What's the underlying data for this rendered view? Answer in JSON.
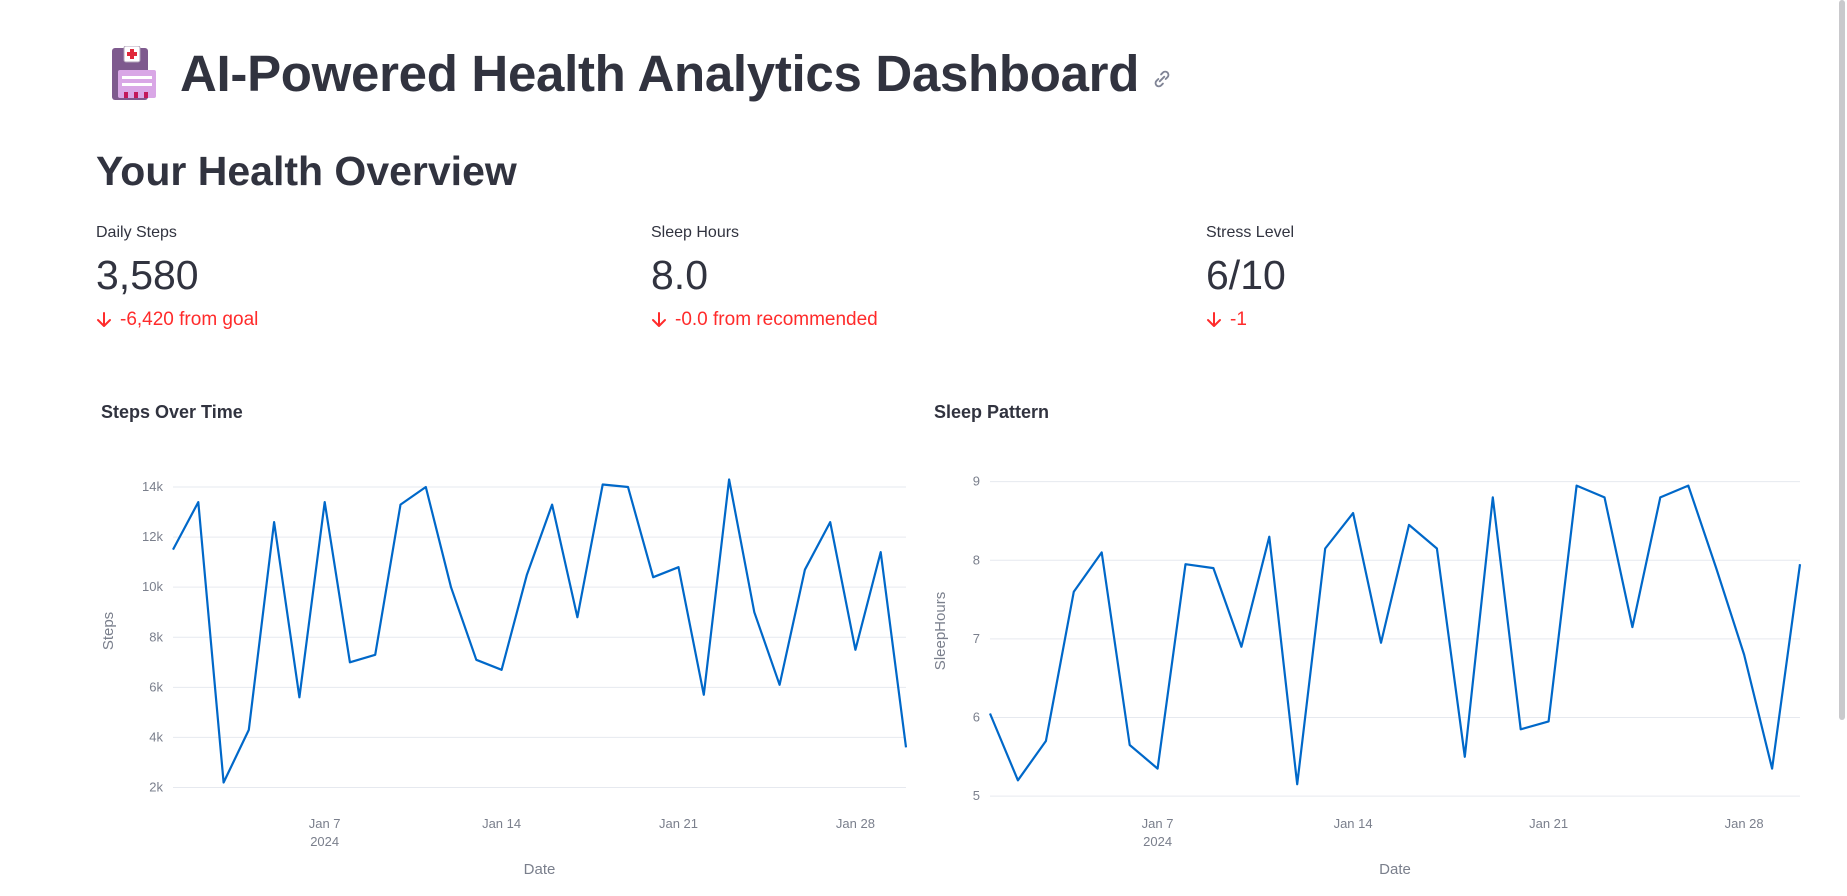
{
  "header": {
    "title": "AI-Powered Health Analytics Dashboard"
  },
  "overview": {
    "title": "Your Health Overview",
    "metrics": [
      {
        "label": "Daily Steps",
        "value": "3,580",
        "delta": "-6,420 from goal"
      },
      {
        "label": "Sleep Hours",
        "value": "8.0",
        "delta": "-0.0 from recommended"
      },
      {
        "label": "Stress Level",
        "value": "6/10",
        "delta": "-1"
      }
    ]
  },
  "colors": {
    "series": "#0068c9",
    "negative_delta": "#ff2b2b",
    "grid": "#e6e9ef"
  },
  "chart_data": [
    {
      "type": "line",
      "title": "Steps Over Time",
      "xlabel": "Date",
      "ylabel": "Steps",
      "x_start": "2024-01-01",
      "x_ticks": [
        "Jan 7",
        "Jan 14",
        "Jan 21",
        "Jan 28"
      ],
      "x_tick_sub": "2024",
      "y_ticks": [
        "2k",
        "4k",
        "6k",
        "8k",
        "10k",
        "12k",
        "14k"
      ],
      "ylim": [
        1500,
        15000
      ],
      "xlim": [
        "2024-01-01",
        "2024-01-30"
      ],
      "values": [
        11500,
        13400,
        2200,
        4300,
        12600,
        5600,
        13400,
        7000,
        7300,
        13300,
        14000,
        10000,
        7100,
        6700,
        10500,
        13300,
        8800,
        14100,
        14000,
        10400,
        10800,
        5700,
        14300,
        9000,
        6100,
        10700,
        12600,
        7500,
        11400,
        3600
      ]
    },
    {
      "type": "line",
      "title": "Sleep Pattern",
      "xlabel": "Date",
      "ylabel": "SleepHours",
      "x_start": "2024-01-01",
      "x_ticks": [
        "Jan 7",
        "Jan 14",
        "Jan 21",
        "Jan 28"
      ],
      "x_tick_sub": "2024",
      "y_ticks": [
        "5",
        "6",
        "7",
        "8",
        "9"
      ],
      "ylim": [
        4.95,
        9.25
      ],
      "xlim": [
        "2024-01-01",
        "2024-01-30"
      ],
      "values": [
        6.05,
        5.2,
        5.7,
        7.6,
        8.1,
        5.65,
        5.35,
        7.95,
        7.9,
        6.9,
        8.3,
        5.15,
        8.15,
        8.6,
        6.95,
        8.45,
        8.15,
        5.5,
        8.8,
        5.85,
        5.95,
        8.95,
        8.8,
        7.15,
        8.8,
        8.95,
        7.9,
        6.8,
        5.35,
        7.95
      ]
    }
  ]
}
